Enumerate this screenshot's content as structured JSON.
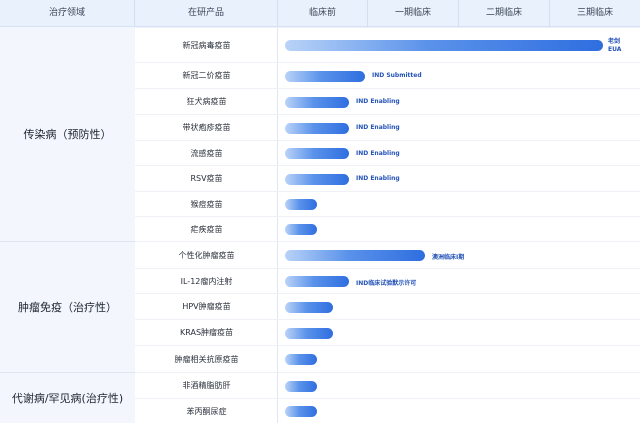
{
  "header": {
    "area": "治疗领域",
    "product": "在研产品",
    "stages": [
      "临床前",
      "一期临床",
      "二期临床",
      "三期临床"
    ]
  },
  "areas": [
    "传染病（预防性）",
    "肿瘤免疫（治疗性）",
    "代谢病/罕见病(治疗性)"
  ],
  "rows": [
    {
      "product": "新冠病毒疫苗",
      "progress": 1.0,
      "label_1": "老剑",
      "label_2": "EUA"
    },
    {
      "product": "新冠二价疫苗",
      "progress": 0.25,
      "label_1": "IND Submitted"
    },
    {
      "product": "狂犬病疫苗",
      "progress": 0.2,
      "label_1": "IND Enabling"
    },
    {
      "product": "带状疱疹疫苗",
      "progress": 0.2,
      "label_1": "IND Enabling"
    },
    {
      "product": "流感疫苗",
      "progress": 0.2,
      "label_1": "IND Enabling"
    },
    {
      "product": "RSV疫苗",
      "progress": 0.2,
      "label_1": "IND Enabling"
    },
    {
      "product": "猴痘疫苗",
      "progress": 0.1
    },
    {
      "product": "疟疾疫苗",
      "progress": 0.1
    },
    {
      "product": "个性化肿瘤疫苗",
      "progress": 0.44,
      "label_1": "澳洲临床I期"
    },
    {
      "product": "IL-12瘤内注射",
      "progress": 0.2,
      "label_1": "IND临床试验默示许可"
    },
    {
      "product": "HPV肿瘤疫苗",
      "progress": 0.15
    },
    {
      "product": "KRAS肿瘤疫苗",
      "progress": 0.15
    },
    {
      "product": "肿瘤相关抗原疫苗",
      "progress": 0.1
    },
    {
      "product": "非酒精脂肪肝",
      "progress": 0.1
    },
    {
      "product": "苯丙酮尿症",
      "progress": 0.1
    }
  ]
}
